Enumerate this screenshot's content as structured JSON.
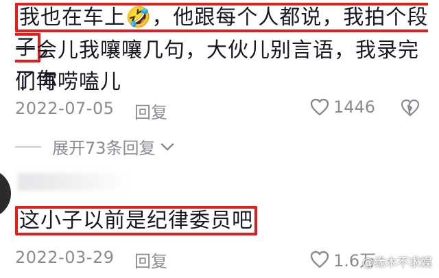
{
  "comments": [
    {
      "highlighted_line": "我也在车上🤣，他跟每个人都说，我拍个段子",
      "line_tail": "，",
      "lines": [
        "一会儿我嚷嚷几句，大伙儿别言语，我录完了你",
        "们再唠嗑儿"
      ],
      "date": "2022-07-05",
      "reply_label": "回复",
      "likes": "1446",
      "expand_label": "展开73条回复"
    },
    {
      "highlighted_line": "这小子以前是纪律委员吧",
      "date": "2022-03-29",
      "reply_label": "回复",
      "likes": "1.6万"
    }
  ],
  "watermark": "@缘木不求娱",
  "icons": {
    "like": "heart-outline-icon",
    "dislike": "broken-heart-icon",
    "expand": "chevron-down-icon"
  },
  "colors": {
    "highlight_border": "#e01e1e",
    "meta_text": "#8a8b91",
    "main_text": "#161823"
  }
}
